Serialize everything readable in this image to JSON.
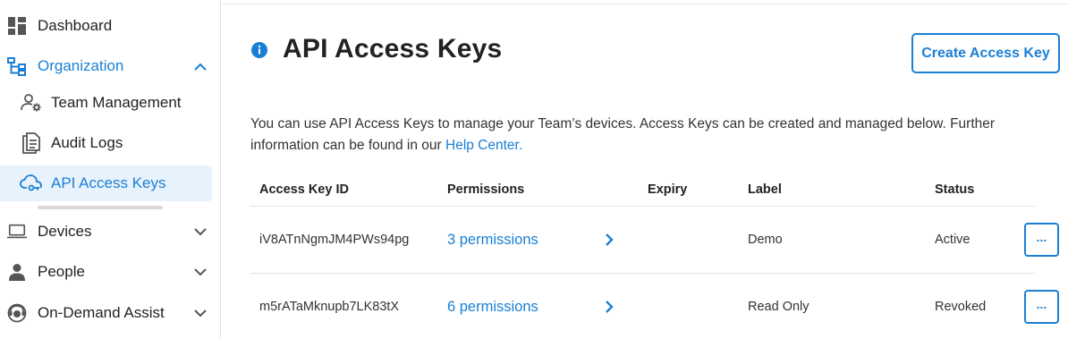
{
  "colors": {
    "accent": "#1a7fd4",
    "active_bg": "#e8f2fc",
    "text": "#222222"
  },
  "sidebar": {
    "dashboard": {
      "label": "Dashboard",
      "icon": "dashboard-grid-icon"
    },
    "organization": {
      "label": "Organization",
      "icon": "org-tree-icon",
      "expanded": true
    },
    "team_management": {
      "label": "Team Management",
      "icon": "team-settings-icon"
    },
    "audit_logs": {
      "label": "Audit Logs",
      "icon": "document-icon"
    },
    "api_access_keys": {
      "label": "API Access Keys",
      "icon": "cloud-key-icon",
      "active": true
    },
    "devices": {
      "label": "Devices",
      "icon": "laptop-icon"
    },
    "people": {
      "label": "People",
      "icon": "person-icon"
    },
    "on_demand_assist": {
      "label": "On-Demand Assist",
      "icon": "headset-agent-icon"
    }
  },
  "main": {
    "title": "API Access Keys",
    "title_icon": "info-icon",
    "create_button": "Create Access Key",
    "description_text": "You can use API Access Keys to manage your Team’s devices. Access Keys can be created and managed below. Further information can be found in our ",
    "description_link": "Help Center."
  },
  "table": {
    "headers": {
      "key_id": "Access Key ID",
      "permissions": "Permissions",
      "expiry": "Expiry",
      "label": "Label",
      "status": "Status"
    },
    "rows": [
      {
        "key_id": "iV8ATnNgmJM4PWs94pg",
        "permissions": "3 permissions",
        "expiry": "",
        "label": "Demo",
        "status": "Active",
        "more": "..."
      },
      {
        "key_id": "m5rATaMknupb7LK83tX",
        "permissions": "6 permissions",
        "expiry": "",
        "label": "Read Only",
        "status": "Revoked",
        "more": "..."
      }
    ]
  }
}
